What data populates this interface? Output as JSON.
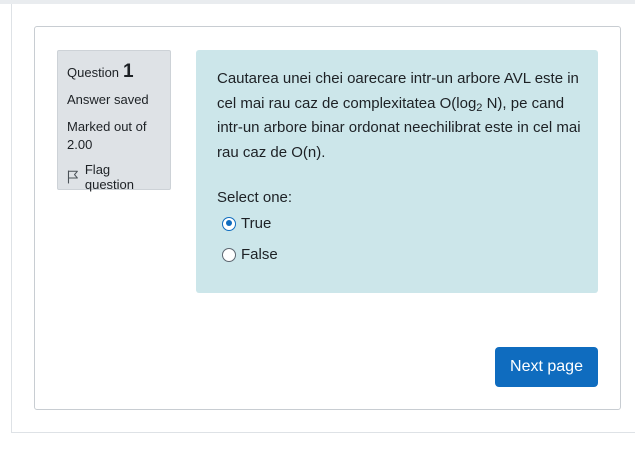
{
  "question_info": {
    "label": "Question",
    "number": "1",
    "state": "Answer saved",
    "grade_line1": "Marked out of",
    "grade_line2": "2.00",
    "flag_label": "Flag question",
    "flag_icon": "flag-icon"
  },
  "question": {
    "text_part1": "Cautarea unei chei oarecare intr-un arbore AVL este in cel mai rau caz de complexitatea O(log",
    "subscript": "2",
    "text_part2": " N), pe cand intr-un arbore binar ordonat neechilibrat este in cel mai rau caz de O(n).",
    "prompt": "Select one:",
    "options": [
      {
        "label": "True",
        "selected": true
      },
      {
        "label": "False",
        "selected": false
      }
    ]
  },
  "navigation": {
    "next_label": "Next page"
  },
  "colors": {
    "content_bg": "#cce6ea",
    "info_bg": "#dee2e6",
    "primary": "#0f6cbf"
  }
}
